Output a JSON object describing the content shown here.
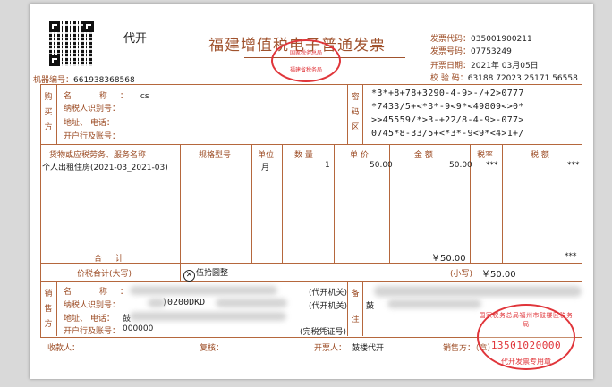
{
  "header": {
    "badge": "代开",
    "title": "福建增值税电子普通发票",
    "machine_label": "机器编号：",
    "machine_no": "661938368568",
    "invoice_code_label": "发票代码：",
    "invoice_code": "035001900211",
    "invoice_no_label": "发票号码：",
    "invoice_no": "07753249",
    "date_label": "开票日期：",
    "date": "2021年 03月05日",
    "check_label": "校 验 码：",
    "check_code": "63188 72023 25171 56558"
  },
  "header_seal": {
    "top": "国家税务总局",
    "bottom": "福建省税务局"
  },
  "buyer": {
    "side_label": [
      "购",
      "买",
      "方"
    ],
    "name_label": "名 称：",
    "name": "cs",
    "taxid_label": "纳税人识别号：",
    "address_label": "地址、 电话：",
    "bank_label": "开户行及账号："
  },
  "cipher": {
    "side_label": [
      "密",
      "码",
      "区"
    ],
    "lines": [
      "*3*+8+78+3290-4-9>-/+2>0777",
      "*7433/5+<*3*-9<9*<49809<>0*",
      ">>45559/*>3-+22/8-4-9>-077>",
      "0745*8-33/5+<*3*-9<9*<4>1+/"
    ]
  },
  "items": {
    "headers": {
      "name": "货物或应税劳务、服务名称",
      "spec": "规格型号",
      "unit": "单位",
      "qty": "数 量",
      "price": "单 价",
      "amount": "金 额",
      "rate": "税率",
      "tax": "税 额"
    },
    "rows": [
      {
        "name": "个人出租住房(2021-03_2021-03)",
        "spec": "",
        "unit": "月",
        "qty": "1",
        "price": "50.00",
        "amount": "50.00",
        "rate": "***",
        "tax": "***"
      }
    ],
    "total_label": "合 计",
    "total_amount": "￥50.00",
    "total_tax": "***"
  },
  "sum": {
    "label": "价税合计(大写)",
    "words": "伍拾圆整",
    "small_label": "(小写)",
    "small": "￥50.00"
  },
  "seller": {
    "side_label": [
      "销",
      "售",
      "方"
    ],
    "name_label": "名 称：",
    "taxid_label": "纳税人识别号：",
    "taxid_partial": ")0200DKD",
    "taxid_suffix": "(代开机关)",
    "name_suffix": "(代开机关)",
    "address_label": "地址、 电话：",
    "address_value": "鼓",
    "bank_label": "开户行及账号：",
    "bank_value": "000000",
    "bank_suffix": "(完税凭证号)",
    "remark_side": [
      "备",
      "注"
    ],
    "remark_value": "鼓"
  },
  "footer": {
    "payee_label": "收款人：",
    "review_label": "复核：",
    "drawer_label": "开票人：",
    "drawer": "鼓楼代开",
    "seller_label": "销售方：（章）"
  },
  "stamp": {
    "ring_text": "国家税务总局福州市鼓楼区税务局",
    "number": "13501020000",
    "bottom": "代开发票专用章"
  }
}
